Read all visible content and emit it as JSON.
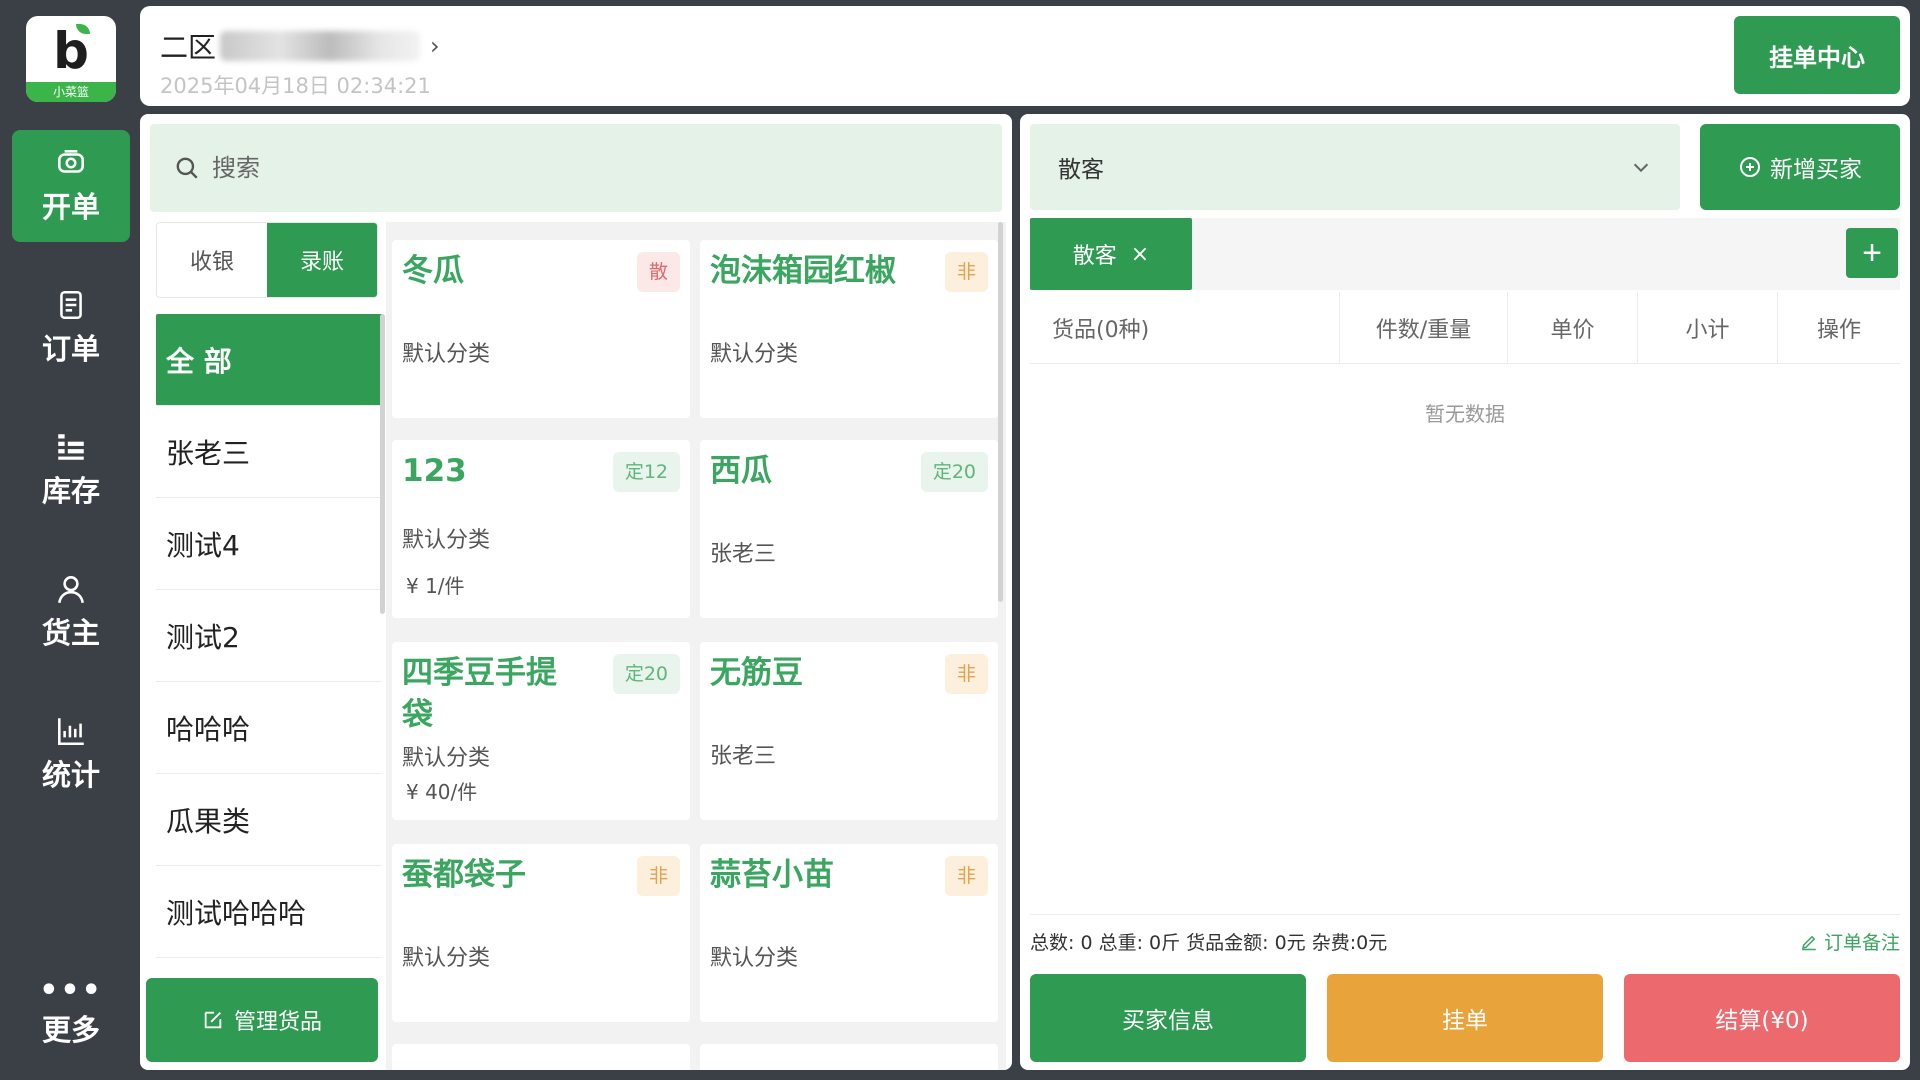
{
  "logo": {
    "glyph": "b",
    "caption": "小菜篮"
  },
  "nav": [
    {
      "label": "开单",
      "icon": "open-order-icon",
      "active": true
    },
    {
      "label": "订单",
      "icon": "order-list-icon",
      "active": false
    },
    {
      "label": "库存",
      "icon": "inventory-icon",
      "active": false
    },
    {
      "label": "货主",
      "icon": "owner-icon",
      "active": false
    },
    {
      "label": "统计",
      "icon": "stats-icon",
      "active": false
    },
    {
      "label": "更多",
      "icon": "more-icon",
      "active": false
    }
  ],
  "header": {
    "shop_name": "二区",
    "datetime": "2025年04月18日 02:34:21",
    "hang_center_label": "挂单中心"
  },
  "search": {
    "placeholder": "搜索"
  },
  "mode_tabs": [
    {
      "label": "收银",
      "active": false
    },
    {
      "label": "录账",
      "active": true
    }
  ],
  "categories": [
    {
      "label": "全 部",
      "active": true
    },
    {
      "label": "张老三",
      "active": false
    },
    {
      "label": "测试4",
      "active": false
    },
    {
      "label": "测试2",
      "active": false
    },
    {
      "label": "哈哈哈",
      "active": false
    },
    {
      "label": "瓜果类",
      "active": false
    },
    {
      "label": "测试哈哈哈",
      "active": false
    }
  ],
  "manage_label": "管理货品",
  "products": [
    {
      "name": "冬瓜",
      "tag": "散",
      "tag_style": "sanred",
      "category": "默认分类",
      "price": ""
    },
    {
      "name": "泡沫箱园红椒",
      "tag": "非",
      "tag_style": "fei",
      "category": "默认分类",
      "price": ""
    },
    {
      "name": "123",
      "tag": "定12",
      "tag_style": "ding",
      "category": "默认分类",
      "price": "¥ 1/件"
    },
    {
      "name": "西瓜",
      "tag": "定20",
      "tag_style": "ding",
      "category": "张老三",
      "price": ""
    },
    {
      "name": "四季豆手提袋",
      "tag": "定20",
      "tag_style": "ding",
      "category": "默认分类",
      "price": "¥ 40/件"
    },
    {
      "name": "无筋豆",
      "tag": "非",
      "tag_style": "fei",
      "category": "张老三",
      "price": ""
    },
    {
      "name": "蚕都袋子",
      "tag": "非",
      "tag_style": "fei",
      "category": "默认分类",
      "price": ""
    },
    {
      "name": "蒜苔小苗",
      "tag": "非",
      "tag_style": "fei",
      "category": "默认分类",
      "price": ""
    }
  ],
  "buyer": {
    "selected": "散客",
    "new_label": "新增买家",
    "tab_label": "散客",
    "tab_close": "×",
    "add_tab": "+"
  },
  "table": {
    "columns": [
      "货品(0种)",
      "件数/重量",
      "单价",
      "小计",
      "操作"
    ],
    "empty_text": "暂无数据"
  },
  "summary": {
    "text": "总数: 0 总重: 0斤 货品金额: 0元 杂费:0元",
    "note_label": "订单备注"
  },
  "actions": {
    "buyer_info": "买家信息",
    "hang": "挂单",
    "checkout": "结算(¥0)"
  },
  "colors": {
    "primary": "#2e9a52",
    "orange": "#e8a43a",
    "red": "#ec6a6e",
    "sidebar_bg": "#3a4046"
  }
}
